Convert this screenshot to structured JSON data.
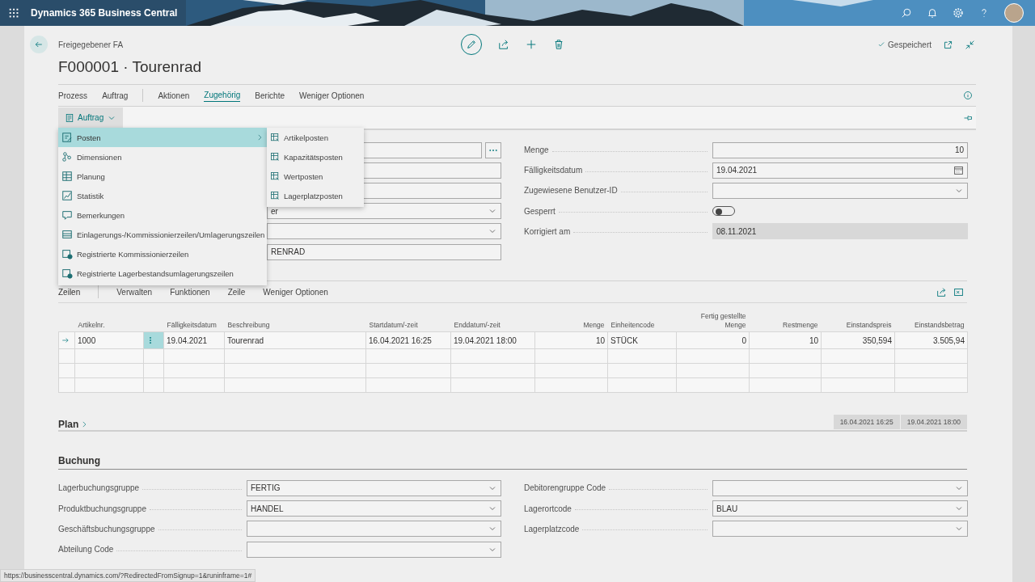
{
  "app_bar": {
    "title": "Dynamics 365 Business Central"
  },
  "header": {
    "breadcrumb": "Freigegebener FA",
    "title": "F000001 · Tourenrad",
    "status": "Gespeichert"
  },
  "actions": [
    {
      "label": "Prozess",
      "selected": false,
      "divider_after": false
    },
    {
      "label": "Auftrag",
      "selected": false,
      "divider_after": true
    },
    {
      "label": "Aktionen",
      "selected": false,
      "divider_after": false
    },
    {
      "label": "Zugehörig",
      "selected": true,
      "divider_after": false
    },
    {
      "label": "Berichte",
      "selected": false,
      "divider_after": false
    },
    {
      "label": "Weniger Optionen",
      "selected": false,
      "divider_after": false
    }
  ],
  "subaction": {
    "label": "Auftrag"
  },
  "menu": [
    {
      "label": "Posten",
      "selected": true,
      "submenu": true
    },
    {
      "label": "Dimensionen",
      "selected": false,
      "submenu": false
    },
    {
      "label": "Planung",
      "selected": false,
      "submenu": false
    },
    {
      "label": "Statistik",
      "selected": false,
      "submenu": false
    },
    {
      "label": "Bemerkungen",
      "selected": false,
      "submenu": false
    },
    {
      "label": "Einlagerungs-/Kommissionierzeilen/Umlagerungszeilen",
      "selected": false,
      "submenu": false
    },
    {
      "label": "Registrierte Kommissionierzeilen",
      "selected": false,
      "submenu": false
    },
    {
      "label": "Registrierte Lagerbestandsumlagerungszeilen",
      "selected": false,
      "submenu": false
    }
  ],
  "submenu": [
    "Artikelposten",
    "Kapazitätsposten",
    "Wertposten",
    "Lagerplatzposten"
  ],
  "general": {
    "left": [
      {
        "kind": "lookup"
      },
      {
        "kind": "text"
      },
      {
        "kind": "text"
      },
      {
        "kind": "select",
        "value": "er"
      },
      {
        "kind": "select"
      },
      {
        "kind": "text",
        "value": "RENRAD"
      }
    ],
    "right": [
      {
        "label": "Menge",
        "kind": "number",
        "value": "10"
      },
      {
        "label": "Fälligkeitsdatum",
        "kind": "date",
        "value": "19.04.2021"
      },
      {
        "label": "Zugewiesene Benutzer-ID",
        "kind": "select"
      },
      {
        "label": "Gesperrt",
        "kind": "toggle",
        "on": false
      },
      {
        "label": "Korrigiert am",
        "kind": "readonly",
        "value": "08.11.2021"
      }
    ]
  },
  "lines": {
    "title": "Zeilen",
    "actions": [
      "Verwalten",
      "Funktionen",
      "Zeile",
      "Weniger Optionen"
    ],
    "columns": [
      {
        "label": "Artikelnr.",
        "kind": "text"
      },
      {
        "label": "Fälligkeitsdatum",
        "kind": "text"
      },
      {
        "label": "Beschreibung",
        "kind": "text"
      },
      {
        "label": "Startdatum/-zeit",
        "kind": "text"
      },
      {
        "label": "Enddatum/-zeit",
        "kind": "text"
      },
      {
        "label": "Menge",
        "kind": "number"
      },
      {
        "label": "Einheitencode",
        "kind": "text"
      },
      {
        "label": "Fertig gestellte Menge",
        "kind": "number"
      },
      {
        "label": "Restmenge",
        "kind": "number"
      },
      {
        "label": "Einstandspreis",
        "kind": "number"
      },
      {
        "label": "Einstandsbetrag",
        "kind": "number"
      }
    ],
    "rows": [
      {
        "current": true,
        "cells": [
          "1000",
          "19.04.2021",
          "Tourenrad",
          "16.04.2021 16:25",
          "19.04.2021 18:00",
          "10",
          "STÜCK",
          "0",
          "10",
          "350,594",
          "3.505,94"
        ]
      }
    ]
  },
  "plan": {
    "title": "Plan",
    "dates": [
      "16.04.2021 16:25",
      "19.04.2021 18:00"
    ]
  },
  "posting": {
    "title": "Buchung",
    "left": [
      {
        "label": "Lagerbuchungsgruppe",
        "kind": "select",
        "value": "FERTIG"
      },
      {
        "label": "Produktbuchungsgruppe",
        "kind": "select",
        "value": "HANDEL"
      },
      {
        "label": "Geschäftsbuchungsgruppe",
        "kind": "select"
      },
      {
        "label": "Abteilung Code",
        "kind": "select"
      }
    ],
    "right": [
      {
        "label": "Debitorengruppe Code",
        "kind": "select"
      },
      {
        "label": "Lagerortcode",
        "kind": "select",
        "value": "BLAU"
      },
      {
        "label": "Lagerplatzcode",
        "kind": "select"
      }
    ]
  },
  "status_bar": {
    "url": "https://businesscentral.dynamics.com/?RedirectedFromSignup=1&runinframe=1#"
  }
}
